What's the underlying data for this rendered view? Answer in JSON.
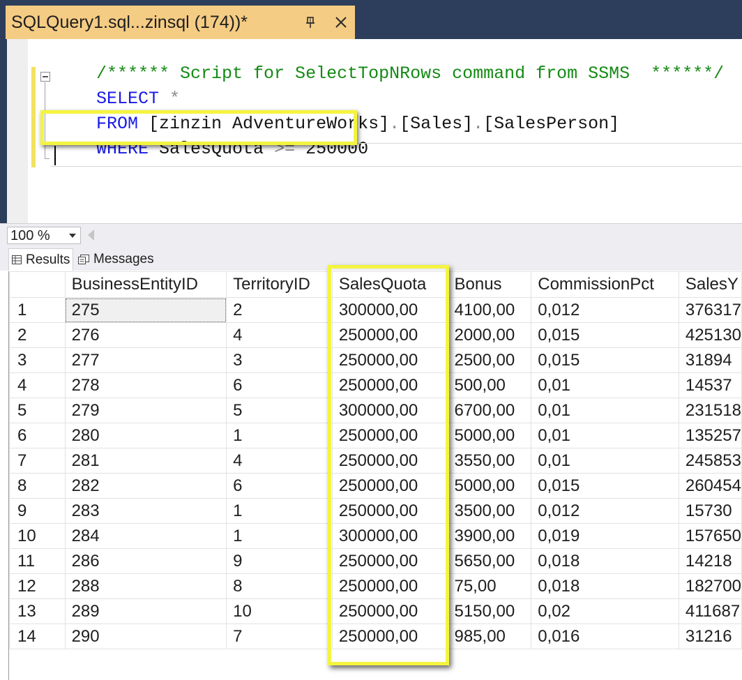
{
  "tab": {
    "title": "SQLQuery1.sql...zinsql (174))*"
  },
  "editor": {
    "comment": "/****** Script for SelectTopNRows command from SSMS  ******/",
    "line2_kw": "SELECT",
    "line2_rest": " *",
    "line3_kw": "FROM",
    "line3_a": " [zinzin AdventureWorks]",
    "line3_dot1": ".",
    "line3_b": "[Sales]",
    "line3_dot2": ".",
    "line3_c": "[SalesPerson]",
    "line4_kw": "WHERE",
    "line4_a": " SalesQuota ",
    "line4_op": ">=",
    "line4_b": " 250000"
  },
  "zoom": {
    "value": "100 %"
  },
  "result_tabs": {
    "results": "Results",
    "messages": "Messages"
  },
  "grid": {
    "columns": [
      "",
      "BusinessEntityID",
      "TerritoryID",
      "SalesQuota",
      "Bonus",
      "CommissionPct",
      "SalesY"
    ],
    "rows": [
      [
        "1",
        "275",
        "2",
        "300000,00",
        "4100,00",
        "0,012",
        "376317"
      ],
      [
        "2",
        "276",
        "4",
        "250000,00",
        "2000,00",
        "0,015",
        "425130"
      ],
      [
        "3",
        "277",
        "3",
        "250000,00",
        "2500,00",
        "0,015",
        "31894"
      ],
      [
        "4",
        "278",
        "6",
        "250000,00",
        "500,00",
        "0,01",
        "14537"
      ],
      [
        "5",
        "279",
        "5",
        "300000,00",
        "6700,00",
        "0,01",
        "231518"
      ],
      [
        "6",
        "280",
        "1",
        "250000,00",
        "5000,00",
        "0,01",
        "135257"
      ],
      [
        "7",
        "281",
        "4",
        "250000,00",
        "3550,00",
        "0,01",
        "245853"
      ],
      [
        "8",
        "282",
        "6",
        "250000,00",
        "5000,00",
        "0,015",
        "260454"
      ],
      [
        "9",
        "283",
        "1",
        "250000,00",
        "3500,00",
        "0,012",
        "15730"
      ],
      [
        "10",
        "284",
        "1",
        "300000,00",
        "3900,00",
        "0,019",
        "157650"
      ],
      [
        "11",
        "286",
        "9",
        "250000,00",
        "5650,00",
        "0,018",
        "14218"
      ],
      [
        "12",
        "288",
        "8",
        "250000,00",
        "75,00",
        "0,018",
        "182700"
      ],
      [
        "13",
        "289",
        "10",
        "250000,00",
        "5150,00",
        "0,02",
        "411687"
      ],
      [
        "14",
        "290",
        "7",
        "250000,00",
        "985,00",
        "0,016",
        "31216"
      ]
    ]
  },
  "colors": {
    "highlight": "#f4f440",
    "tab_active": "#f5cc84",
    "chrome": "#2d3e5c",
    "keyword": "#1a1ae6",
    "comment": "#148a14"
  }
}
